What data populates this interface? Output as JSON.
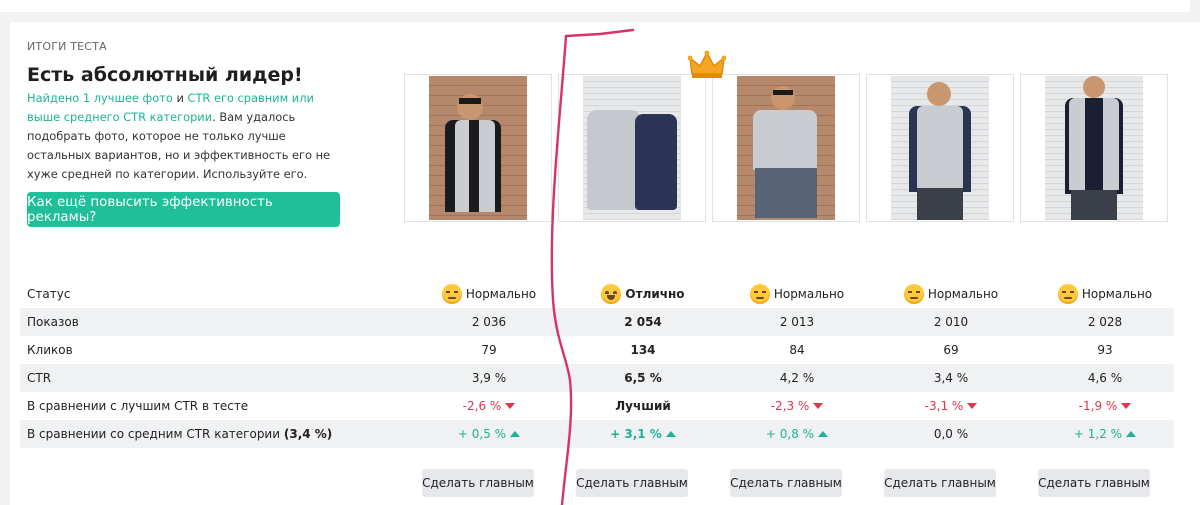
{
  "section": {
    "eyebrow": "ИТОГИ ТЕСТА",
    "headline": "Есть абсолютный лидер!",
    "desc_hl1": "Найдено 1 лучшее фото",
    "desc_and": " и ",
    "desc_hl2": "CTR его сравним или выше среднего CTR категории",
    "desc_rest": ". Вам удалось подобрать фото, которое не только лучше остальных вариантов, но и эффективность его не хуже средней по категории. Используйте его.",
    "cta_label": "Как ещё повысить эффективность рекламы?"
  },
  "table": {
    "labels": {
      "status": "Статус",
      "views": "Показов",
      "clicks": "Кликов",
      "ctr": "CTR",
      "vs_best": "В сравнении с лучшим CTR в тесте",
      "vs_cat": "В сравнении со средним CTR категории ",
      "vs_cat_value": "(3,4 %)"
    },
    "columns": [
      {
        "status": "Нормально",
        "views": "2 036",
        "clicks": "79",
        "ctr": "3,9 %",
        "vs_best": "-2,6 %",
        "vs_cat": "+ 0,5 %"
      },
      {
        "status": "Отлично",
        "views": "2 054",
        "clicks": "134",
        "ctr": "6,5 %",
        "vs_best": "Лучший",
        "vs_cat": "+ 3,1 %"
      },
      {
        "status": "Нормально",
        "views": "2 013",
        "clicks": "84",
        "ctr": "4,2 %",
        "vs_best": "-2,3 %",
        "vs_cat": "+ 0,8 %"
      },
      {
        "status": "Нормально",
        "views": "2 010",
        "clicks": "69",
        "ctr": "3,4 %",
        "vs_best": "-3,1 %",
        "vs_cat": "0,0 %"
      },
      {
        "status": "Нормально",
        "views": "2 028",
        "clicks": "93",
        "ctr": "4,6 %",
        "vs_best": "-1,9 %",
        "vs_cat": "+ 1,2 %"
      }
    ],
    "make_main_label": "Сделать главным"
  },
  "icons": {
    "neutral": "neutral-face-icon",
    "happy": "grinning-face-icon",
    "crown": "crown-icon",
    "down": "triangle-down-icon",
    "up": "triangle-up-icon"
  },
  "colors": {
    "accent": "#1ebf99",
    "negative": "#e0354a",
    "positive": "#1eb394",
    "annotation": "#d6336c"
  }
}
